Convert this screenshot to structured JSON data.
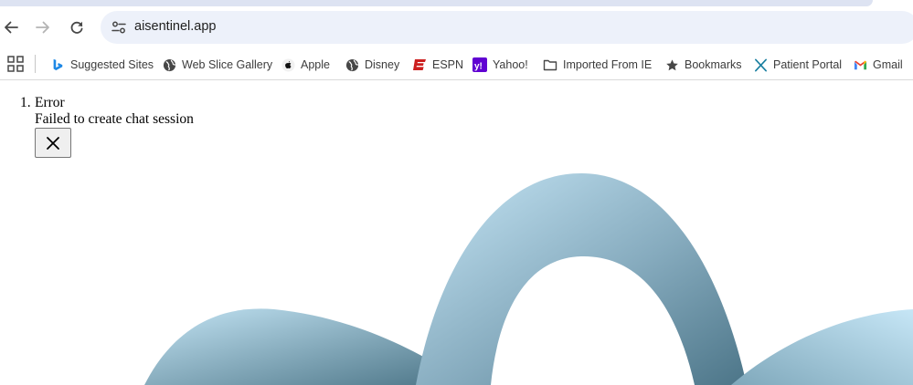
{
  "browser": {
    "url": "aisentinel.app",
    "icons": {
      "back": "arrow-left-icon",
      "forward": "arrow-right-icon",
      "reload": "reload-icon",
      "site_info": "tune-icon",
      "apps": "apps-grid-icon"
    }
  },
  "bookmarks": [
    {
      "label": "Suggested Sites",
      "icon": "bing-icon"
    },
    {
      "label": "Web Slice Gallery",
      "icon": "globe-icon"
    },
    {
      "label": "Apple",
      "icon": "apple-icon"
    },
    {
      "label": "Disney",
      "icon": "globe-icon"
    },
    {
      "label": "ESPN",
      "icon": "espn-icon"
    },
    {
      "label": "Yahoo!",
      "icon": "yahoo-icon"
    },
    {
      "label": "Imported From IE",
      "icon": "folder-icon"
    },
    {
      "label": "Bookmarks",
      "icon": "star-icon"
    },
    {
      "label": "Patient Portal",
      "icon": "x-logo-icon"
    },
    {
      "label": "Gmail",
      "icon": "gmail-icon"
    }
  ],
  "toast": {
    "number": "1.",
    "title": "Error",
    "description": "Failed to create chat session",
    "close_icon": "close-icon"
  },
  "colors": {
    "omnibox": "#edf1fa",
    "arc_light": "#c3e4f4",
    "arc_dark": "#4b7486"
  }
}
